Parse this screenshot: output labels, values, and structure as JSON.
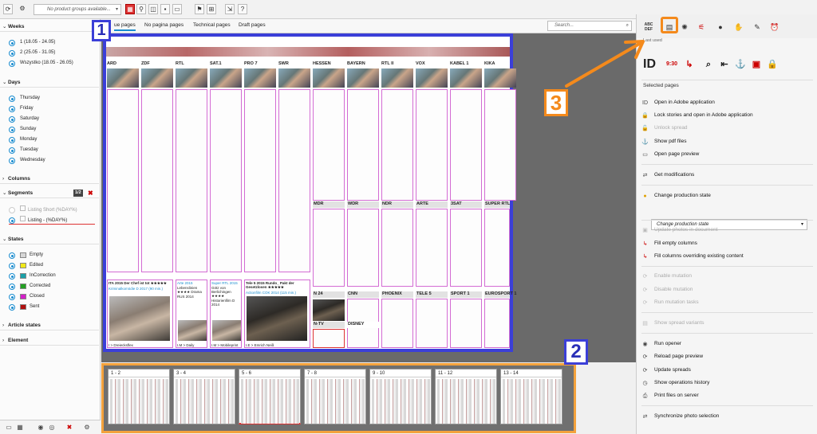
{
  "toolbar": {
    "product_groups_placeholder": "No product groups available...",
    "caret": "▾"
  },
  "left": {
    "weeks_title": "Weeks",
    "weeks": [
      "1 (18.05 - 24.05)",
      "2 (25.05 - 31.05)",
      "Wszystko (18.05 - 26.05)"
    ],
    "days_title": "Days",
    "days": [
      "Thursday",
      "Friday",
      "Saturday",
      "Sunday",
      "Monday",
      "Tuesday",
      "Wednesday"
    ],
    "columns_title": "Columns",
    "segments_title": "Segments",
    "segments_page": "1/2",
    "segments": [
      "Listing Short (%DAY%)",
      "Listing - (%DAY%)"
    ],
    "states_title": "States",
    "states": [
      {
        "label": "Empty",
        "color": "#d7d7d7"
      },
      {
        "label": "Edited",
        "color": "#f0e817"
      },
      {
        "label": "InCorrection",
        "color": "#1aa0a8"
      },
      {
        "label": "Corrected",
        "color": "#23a023"
      },
      {
        "label": "Closed",
        "color": "#d420c8"
      },
      {
        "label": "Sent",
        "color": "#b01010"
      }
    ],
    "article_states_title": "Article states",
    "element_title": "Element"
  },
  "tabs": [
    "ue pages",
    "No pagina pages",
    "Technical pages",
    "Draft pages"
  ],
  "search_placeholder": "Search...",
  "channels_top": [
    "ARD",
    "ZDF",
    "RTL",
    "SAT.1",
    "PRO 7",
    "SWR",
    "HESSEN",
    "BAYERN",
    "RTL II",
    "VOX",
    "KABEL 1",
    "KIKA"
  ],
  "channels_mid": [
    "MDR",
    "WDR",
    "NDR",
    "ARTE",
    "3SAT",
    "SUPER RTL"
  ],
  "channels_low": [
    "N 24",
    "CNN",
    "PHOENIX",
    "TELE 5",
    "SPORT 1",
    "EUROSPORT 1"
  ],
  "channels_bottom": [
    "N-TV",
    "DISNEY"
  ],
  "articles": [
    {
      "head": "ITA 2015 Der Chef ist tot ★★★★★",
      "sub": "Kriminalkomödie D 2017 (90 min.)"
    },
    {
      "head": "Arte 2015",
      "sub": "Lebenslinien ★★★★ Drama RUS 2014"
    },
    {
      "head": "Super RTL 2015",
      "sub": "Götz von Berlichingen ★★★★ Historienfilm D 2014"
    },
    {
      "head": "Tele 5 2015 Rundo_ Pakt der Gesetzlosen ★★★★★",
      "sub": "Actionfilm COK 2014 (115 min.)"
    }
  ],
  "article_footers": [
    "I > Dreiecksflex",
    "I.M > Ende",
    "I.M > Daily",
    "I.M > Mobileprint",
    "I.E > Emrich Neiß"
  ],
  "thumbs": [
    "1 - 2",
    "3 - 4",
    "5 - 6",
    "7 - 8",
    "9 - 10",
    "11 - 12",
    "13 - 14"
  ],
  "right": {
    "last_used": "Last used",
    "selected_pages": "Selected pages",
    "items": [
      {
        "label": "Open in Adobe application",
        "icon": "ID",
        "enabled": true
      },
      {
        "label": "Lock stories and open in Adobe application",
        "icon": "🔒",
        "enabled": true
      },
      {
        "label": "Unlock spread",
        "icon": "🔓",
        "enabled": false
      },
      {
        "label": "Show pdf files",
        "icon": "⚓",
        "enabled": true
      },
      {
        "label": "Open page preview",
        "icon": "▭",
        "enabled": true
      },
      {
        "label": "Get modifications",
        "icon": "⇄",
        "enabled": true
      },
      {
        "label": "Change production state",
        "icon": "●",
        "enabled": true
      },
      {
        "label": "Update photos in document",
        "icon": "▣",
        "enabled": false
      },
      {
        "label": "Fill empty columns",
        "icon": "↳",
        "enabled": true
      },
      {
        "label": "Fill columns overriding existing content",
        "icon": "↳",
        "enabled": true
      },
      {
        "label": "Enable mutation",
        "icon": "⟳",
        "enabled": false
      },
      {
        "label": "Disable mutation",
        "icon": "⟳",
        "enabled": false
      },
      {
        "label": "Run mutation tasks",
        "icon": "⟳",
        "enabled": false
      },
      {
        "label": "Show spread variants",
        "icon": "▤",
        "enabled": false
      },
      {
        "label": "Run opener",
        "icon": "◉",
        "enabled": true
      },
      {
        "label": "Reload page preview",
        "icon": "⟳",
        "enabled": true
      },
      {
        "label": "Update spreads",
        "icon": "⟳",
        "enabled": true
      },
      {
        "label": "Show operations history",
        "icon": "◷",
        "enabled": true
      },
      {
        "label": "Print files on server",
        "icon": "⎙",
        "enabled": true
      },
      {
        "label": "Synchronize photo selection",
        "icon": "⇄",
        "enabled": true
      }
    ],
    "production_state_placeholder": "Change production state"
  },
  "callouts": [
    "1",
    "2",
    "3"
  ],
  "colors": {
    "blue_callout": "#3b3fd8",
    "orange_callout": "#f48a1c",
    "accent": "#1a8ccf"
  }
}
